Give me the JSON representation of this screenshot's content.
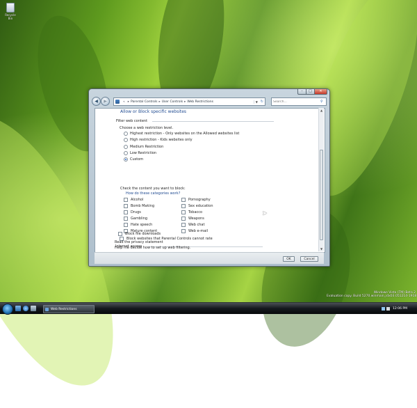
{
  "desktop": {
    "recycle_bin_label": "Recycle Bin",
    "watermark": {
      "line1": "Windows Vista (TM) Beta 2",
      "line2": "Evaluation copy. Build 5270.winmain_idx03.051214-1918"
    }
  },
  "window": {
    "address": {
      "crumbs": [
        "Parental Controls",
        "User Controls",
        "Web Restrictions"
      ],
      "separator": "▸",
      "nav_prefix": "«"
    },
    "search": {
      "placeholder": "Search..."
    },
    "page_title": "Allow or Block specific websites",
    "filter_section": {
      "title": "Filter web content",
      "restriction_heading": "Choose a web restriction level.",
      "options": [
        {
          "label": "Highest restriction - Only websites on the Allowed websites list",
          "selected": false
        },
        {
          "label": "High restriction - Kids websites only",
          "selected": false
        },
        {
          "label": "Medium Restriction",
          "selected": false
        },
        {
          "label": "Low Restriction",
          "selected": false
        },
        {
          "label": "Custom",
          "selected": true
        }
      ]
    },
    "block_section": {
      "title": "Check the content you want to block:",
      "how_link": "How do these categories work?",
      "categories_left": [
        "Alcohol",
        "Bomb Making",
        "Drugs",
        "Gambling",
        "Hate speech",
        "Mature content"
      ],
      "categories_right": [
        "Pornography",
        "Sex education",
        "Tobacco",
        "Weapons",
        "Web chat",
        "Web e-mail"
      ],
      "block_unrated": "Block websites that Parental Controls cannot rate"
    },
    "internet_section": {
      "title": "Internet access",
      "block_downloads": "Block file downloads"
    },
    "privacy_link": "Read the privacy statement",
    "help_link": "Help me decide how to set up web filtering.",
    "buttons": {
      "ok": "OK",
      "cancel": "Cancel"
    }
  },
  "taskbar": {
    "task_label": "Web Restrictions",
    "clock": "12:06 PM"
  }
}
